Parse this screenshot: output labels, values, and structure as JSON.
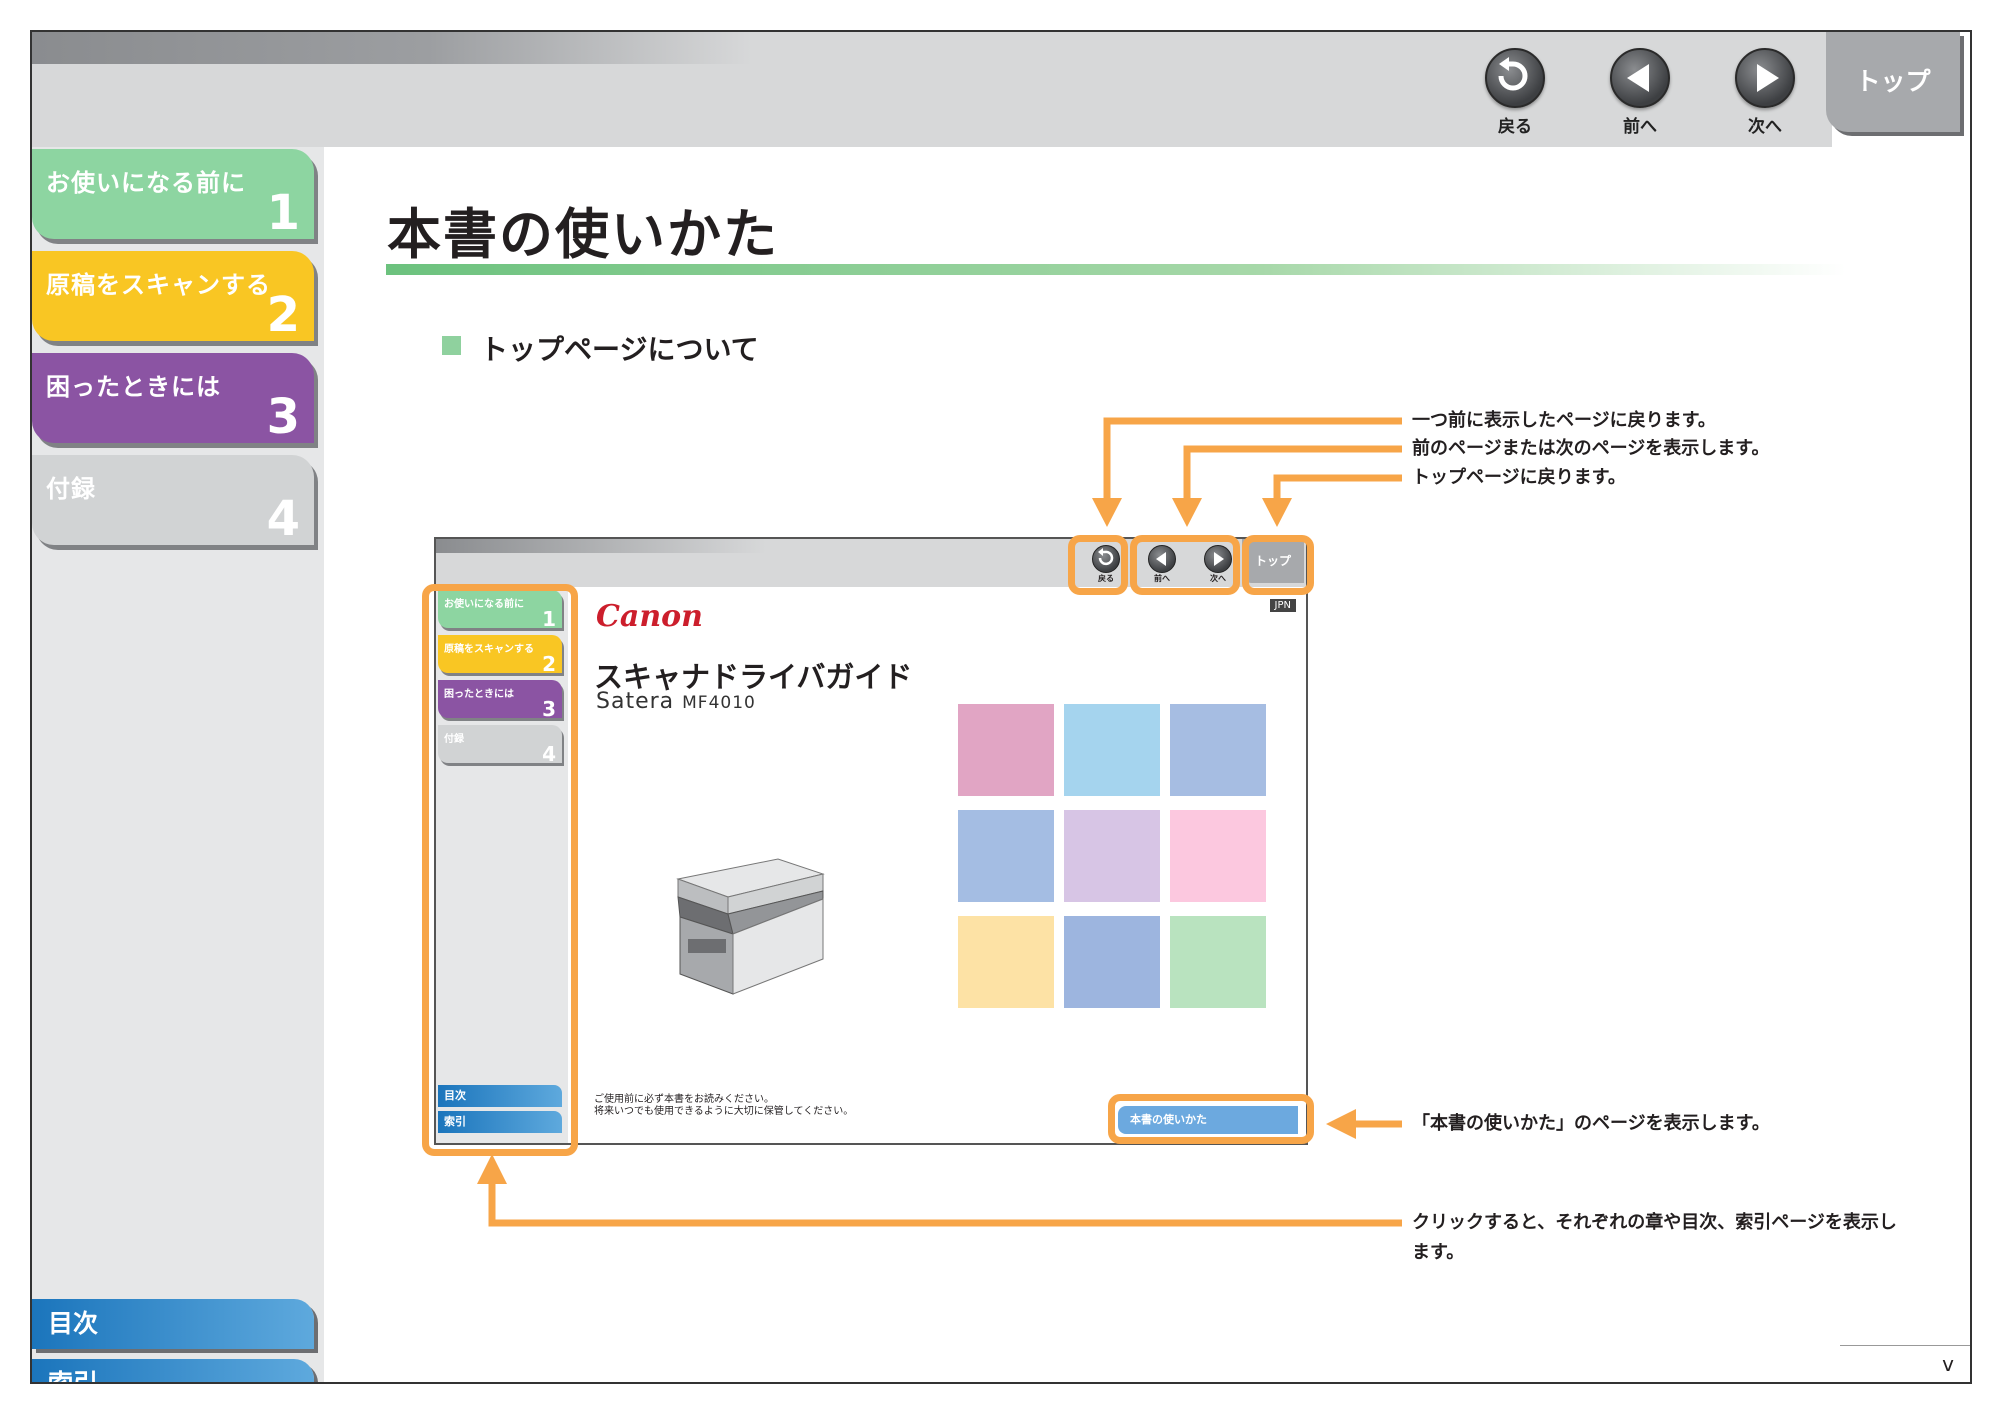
{
  "header": {
    "nav": {
      "back": "戻る",
      "prev": "前へ",
      "next": "次へ",
      "top": "トップ"
    }
  },
  "sidebar": {
    "chapters": [
      {
        "label": "お使いになる前に",
        "num": "1",
        "color": "#8dd5a1"
      },
      {
        "label": "原稿をスキャンする",
        "num": "2",
        "color": "#f9c623"
      },
      {
        "label": "困ったときには",
        "num": "3",
        "color": "#8b54a3"
      },
      {
        "label": "付録",
        "num": "4",
        "color": "#d1d3d4"
      }
    ],
    "contents": "目次",
    "index": "索引"
  },
  "main": {
    "title": "本書の使いかた",
    "section": "トップページについて",
    "callouts": {
      "back": "一つ前に表示したページに戻ります。",
      "prevnext": "前のページまたは次のページを表示します。",
      "top": "トップページに戻ります。",
      "howto": "「本書の使いかた」のページを表示します。",
      "chapters": "クリックすると、それぞれの章や目次、索引ページを表示します。"
    },
    "page_number": "v"
  },
  "mockup": {
    "nav": {
      "back": "戻る",
      "prev": "前へ",
      "next": "次へ",
      "top": "トップ"
    },
    "chapters": [
      {
        "label": "お使いになる前に",
        "num": "1",
        "color": "#8dd5a1"
      },
      {
        "label": "原稿をスキャンする",
        "num": "2",
        "color": "#f9c623"
      },
      {
        "label": "困ったときには",
        "num": "3",
        "color": "#8b54a3"
      },
      {
        "label": "付録",
        "num": "4",
        "color": "#d1d3d4"
      }
    ],
    "contents": "目次",
    "index": "索引",
    "brand": "Canon",
    "lang": "JPN",
    "guide_title": "スキャナドライバガイド",
    "product": "Satera",
    "model": "MF4010",
    "note_line1": "ご使用前に必ず本書をお読みください。",
    "note_line2": "将来いつでも使用できるように大切に保管してください。",
    "howto": "本書の使いかた",
    "squares": [
      "#e1a5c4",
      "#a5d4ee",
      "#a6bde2",
      "#a4bde3",
      "#d7c5e5",
      "#fcc8df",
      "#fde2a5",
      "#9db5df",
      "#b9e3bf"
    ]
  }
}
